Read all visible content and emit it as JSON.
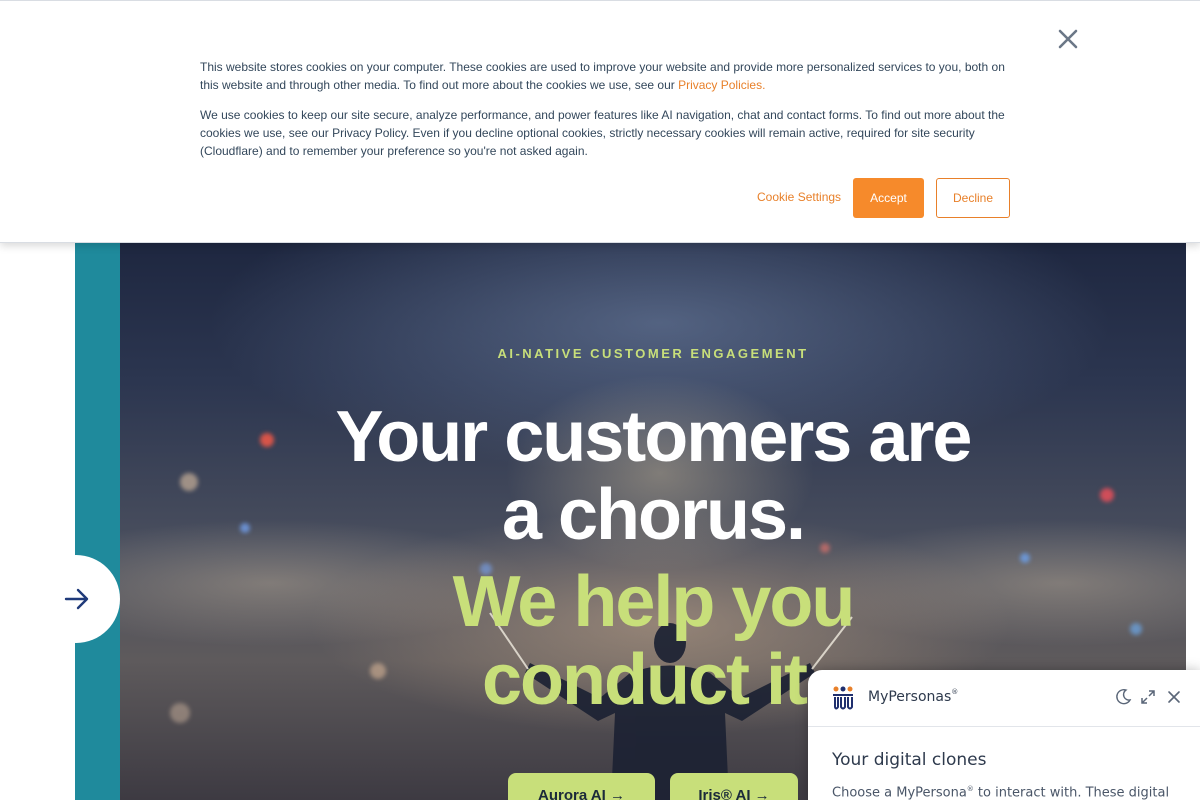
{
  "cookie_banner": {
    "paragraph1": "This website stores cookies on your computer. These cookies are used to improve your website and provide more personalized services to you, both on this website and through other media. To find out more about the cookies we use, see our ",
    "privacy_link": "Privacy Policies.",
    "paragraph2": "We use cookies to keep our site secure, analyze performance, and power features like AI navigation, chat and contact forms. To find out more about the cookies we use, see our Privacy Policy. Even if you decline optional cookies, strictly necessary cookies will remain active, required for site security (Cloudflare) and to remember your preference so you're not asked again.",
    "settings_label": "Cookie Settings",
    "accept_label": "Accept",
    "decline_label": "Decline",
    "close_icon": "close-icon",
    "accent_color": "#f68a2b"
  },
  "hero": {
    "eyebrow": "AI-NATIVE CUSTOMER ENGAGEMENT",
    "headline_line1": "Your customers are",
    "headline_line2": "a chorus.",
    "accent_line1": "We help you",
    "accent_line2": "conduct it.",
    "cta_primary": "Aurora AI →",
    "cta_secondary": "Iris® AI →",
    "accent_color": "#c8df7a",
    "strip_color": "#1f8a9c"
  },
  "side_nav": {
    "arrow_icon": "arrow-right-icon"
  },
  "widget": {
    "title": "MyPersonas",
    "title_mark": "®",
    "heading": "Your digital clones",
    "body_start": "Choose a MyPersona",
    "body_mark": "®",
    "body_end": " to interact with. These digital",
    "icons": [
      "moon-icon",
      "expand-icon",
      "close-icon"
    ]
  }
}
